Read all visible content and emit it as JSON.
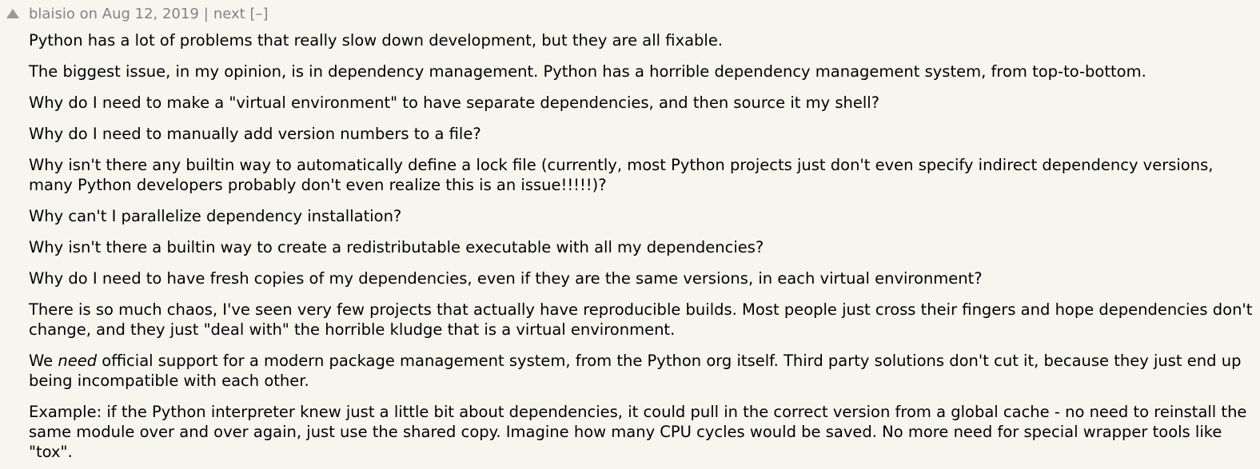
{
  "comment": {
    "user": "blaisio",
    "on": "on",
    "date": "Aug 12, 2019",
    "separator": "|",
    "next": "next",
    "toggle": "[–]",
    "vote_icon": "upvote-triangle-icon",
    "paragraphs": [
      "Python has a lot of problems that really slow down development, but they are all fixable.",
      "The biggest issue, in my opinion, is in dependency management. Python has a horrible dependency management system, from top-to-bottom.",
      "Why do I need to make a \"virtual environment\" to have separate dependencies, and then source it my shell?",
      "Why do I need to manually add version numbers to a file?",
      "Why isn't there any builtin way to automatically define a lock file (currently, most Python projects just don't even specify indirect dependency versions, many Python developers probably don't even realize this is an issue!!!!!)?",
      "Why can't I parallelize dependency installation?",
      "Why isn't there a builtin way to create a redistributable executable with all my dependencies?",
      "Why do I need to have fresh copies of my dependencies, even if they are the same versions, in each virtual environment?",
      "There is so much chaos, I've seen very few projects that actually have reproducible builds. Most people just cross their fingers and hope dependencies don't change, and they just \"deal with\" the horrible kludge that is a virtual environment."
    ],
    "p10_before": "We ",
    "p10_emphasis": "need",
    "p10_after": " official support for a modern package management system, from the Python org itself. Third party solutions don't cut it, because they just end up being incompatible with each other.",
    "p11": "Example: if the Python interpreter knew just a little bit about dependencies, it could pull in the correct version from a global cache - no need to reinstall the same module over and over again, just use the shared copy. Imagine how many CPU cycles would be saved. No more need for special wrapper tools like \"tox\"."
  }
}
